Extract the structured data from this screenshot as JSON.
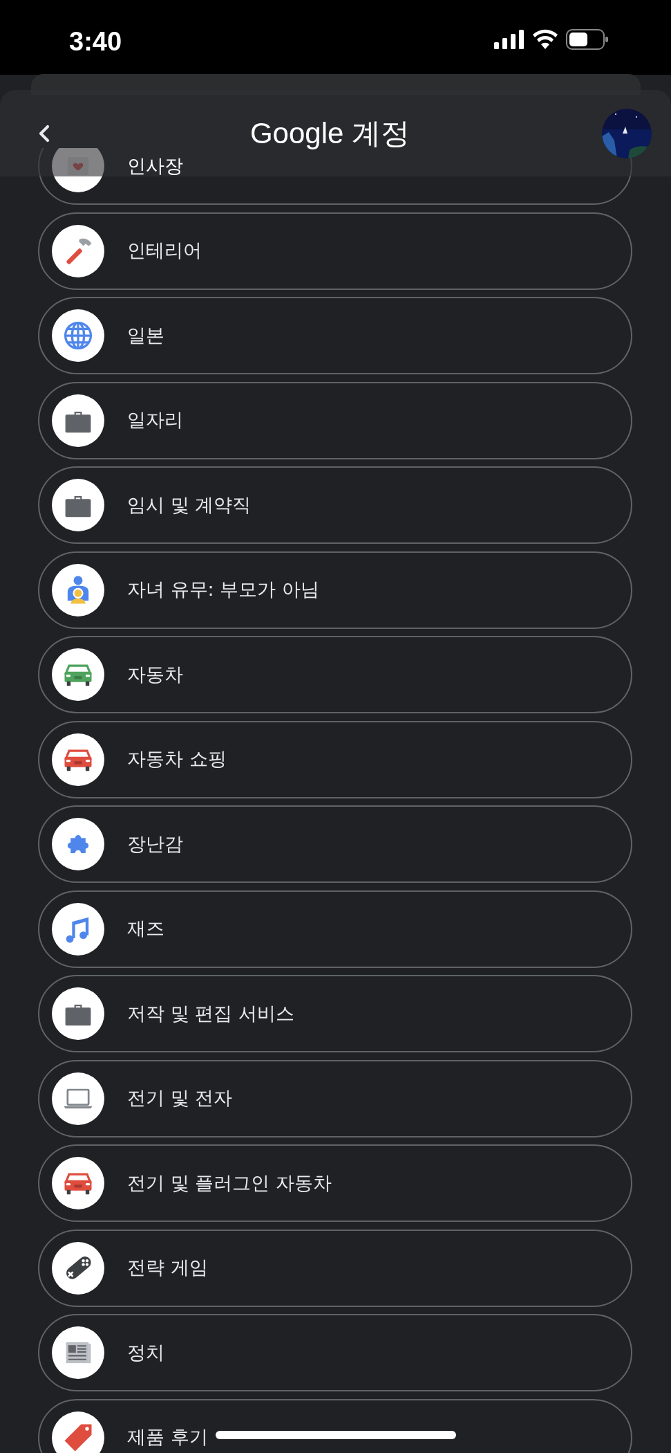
{
  "status_bar": {
    "time": "3:40"
  },
  "header": {
    "title": "Google 계정"
  },
  "items": [
    {
      "label": "인사장",
      "kind": "card"
    },
    {
      "label": "인테리어",
      "kind": "hammer"
    },
    {
      "label": "일본",
      "kind": "globe"
    },
    {
      "label": "일자리",
      "kind": "briefcase"
    },
    {
      "label": "임시 및 계약직",
      "kind": "briefcase"
    },
    {
      "label": "자녀 유무: 부모가 아님",
      "kind": "family"
    },
    {
      "label": "자동차",
      "kind": "car",
      "color": "#4fa35d"
    },
    {
      "label": "자동차 쇼핑",
      "kind": "car",
      "color": "#df4d3f"
    },
    {
      "label": "장난감",
      "kind": "puzzle"
    },
    {
      "label": "재즈",
      "kind": "music"
    },
    {
      "label": "저작 및 편집 서비스",
      "kind": "briefcase"
    },
    {
      "label": "전기 및 전자",
      "kind": "laptop"
    },
    {
      "label": "전기 및 플러그인 자동차",
      "kind": "car",
      "color": "#df4d3f"
    },
    {
      "label": "전략 게임",
      "kind": "gamepad"
    },
    {
      "label": "정치",
      "kind": "newspaper"
    },
    {
      "label": "제품 후기",
      "kind": "tag"
    }
  ]
}
